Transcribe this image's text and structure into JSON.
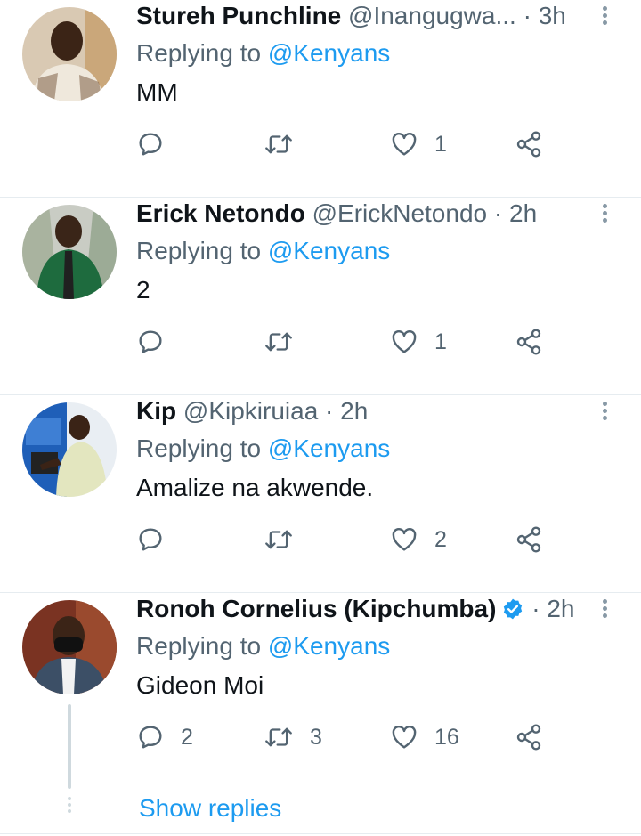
{
  "tweets": [
    {
      "name": "Stureh Punchline",
      "handle": "@Inangugwa...",
      "dot": "·",
      "time": "3h",
      "replying_prefix": "Replying to",
      "replying_to": "@Kenyans",
      "text": "MM",
      "replies": "",
      "retweets": "",
      "likes": "1"
    },
    {
      "name": "Erick Netondo",
      "handle": "@ErickNetondo",
      "dot": "·",
      "time": "2h",
      "replying_prefix": "Replying to",
      "replying_to": "@Kenyans",
      "text": "2",
      "replies": "",
      "retweets": "",
      "likes": "1"
    },
    {
      "name": "Kip",
      "handle": "@Kipkiruiaa",
      "dot": "·",
      "time": "2h",
      "replying_prefix": "Replying to",
      "replying_to": "@Kenyans",
      "text": "Amalize na akwende.",
      "replies": "",
      "retweets": "",
      "likes": "2"
    },
    {
      "name": "Ronoh Cornelius (Kipchumba)",
      "handle": "",
      "verified": true,
      "dot": "·",
      "time": "2h",
      "replying_prefix": "Replying to",
      "replying_to": "@Kenyans",
      "text": "Gideon Moi",
      "replies": "2",
      "retweets": "3",
      "likes": "16"
    }
  ],
  "show_replies": "Show replies",
  "colors": {
    "accent": "#1d9bf0",
    "secondary_text": "#536471",
    "divider": "#e6ecf0"
  },
  "icons": [
    "reply-icon",
    "retweet-icon",
    "like-icon",
    "share-icon",
    "more-icon",
    "verified-badge-icon"
  ]
}
